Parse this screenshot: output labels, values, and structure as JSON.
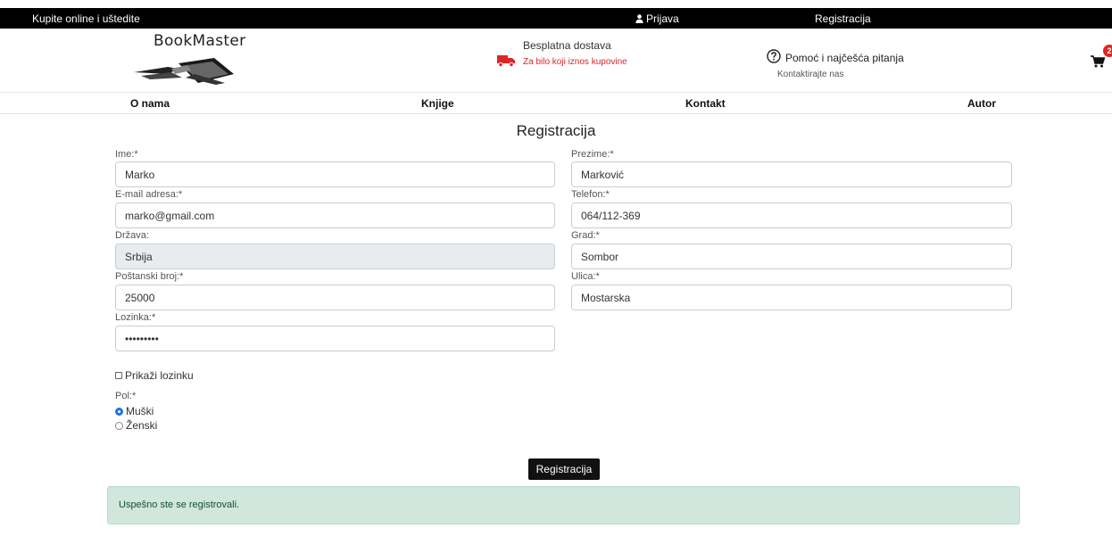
{
  "topbar": {
    "promo": "Kupite online i uštedite",
    "login": "Prijava",
    "register": "Registracija"
  },
  "header": {
    "logo": "BookMaster",
    "delivery_title": "Besplatna dostava",
    "delivery_sub": "Za bilo koji iznos kupovine",
    "help_title": "Pomoć i najčešća pitanja",
    "help_sub": "Kontaktirajte nas",
    "cart_count": "2"
  },
  "nav": {
    "about": "O nama",
    "books": "Knjige",
    "contact": "Kontakt",
    "author": "Autor"
  },
  "form": {
    "title": "Registracija",
    "first_name": {
      "label": "Ime:*",
      "value": "Marko"
    },
    "last_name": {
      "label": "Prezime:*",
      "value": "Marković"
    },
    "email": {
      "label": "E-mail adresa:*",
      "value": "marko@gmail.com"
    },
    "phone": {
      "label": "Telefon:*",
      "value": "064/112-369"
    },
    "country": {
      "label": "Država:",
      "value": "Srbija"
    },
    "city": {
      "label": "Grad:*",
      "value": "Sombor"
    },
    "postal": {
      "label": "Poštanski broj:*",
      "value": "25000"
    },
    "street": {
      "label": "Ulica:*",
      "value": "Mostarska"
    },
    "password": {
      "label": "Lozinka:*",
      "value": "•••••••••"
    },
    "show_password": "Prikaži lozinku",
    "gender_label": "Pol:*",
    "male": "Muški",
    "female": "Ženski",
    "submit": "Registracija",
    "success": "Uspešno ste se registrovali."
  },
  "colors": {
    "accent_red": "#e02424",
    "success_bg": "#d1e7dd",
    "success_text": "#0f5132"
  }
}
